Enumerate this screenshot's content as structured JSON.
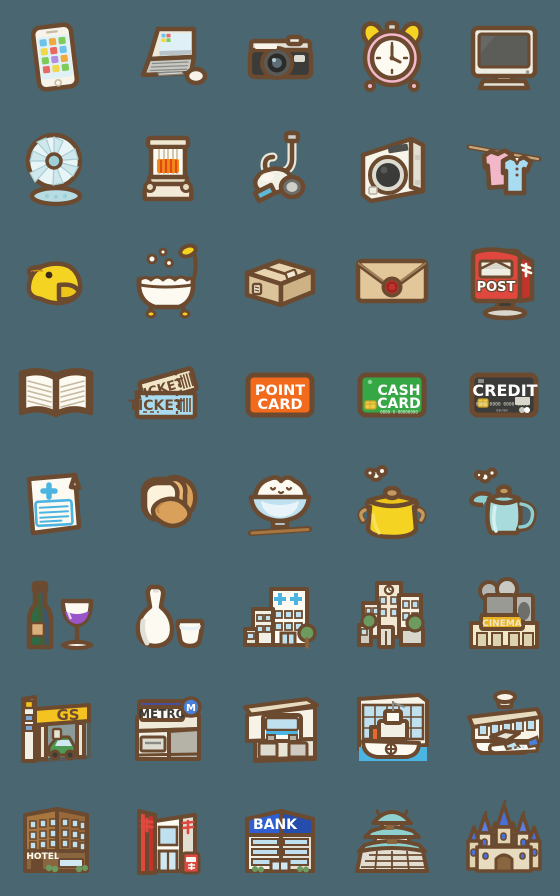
{
  "page": {
    "kind": "emoji-sticker-pack-preview",
    "background_color": "#4a6670",
    "outline_color": "#6b4a2f",
    "columns": 5,
    "rows": 8,
    "cell_size": 112,
    "total_icons": 40
  },
  "palette": {
    "background": "#4a6670",
    "outline": "#6b4a2f",
    "outline_light": "#8a6640",
    "white": "#fdfaf2",
    "cream": "#f2e6c8",
    "yellow": "#f5d322",
    "yellow_deep": "#e8c20c",
    "orange": "#f26a1b",
    "green": "#35a845",
    "green_dark": "#2e7d33",
    "red": "#e0483f",
    "red_dark": "#c2332c",
    "pink": "#f2b7c8",
    "blue": "#7fcbe0",
    "blue_light": "#bfe6f2",
    "blue_deep": "#2f5fd0",
    "teal": "#8ecfcf",
    "gray": "#b5b5b2",
    "gray_dark": "#4f4f4d",
    "purple": "#9a55c9",
    "tan": "#d9b07c",
    "brown": "#a87a4a"
  },
  "icons": [
    {
      "row": 1,
      "col": 1,
      "name": "smartphone-icon",
      "label": "Smartphone"
    },
    {
      "row": 1,
      "col": 2,
      "name": "laptop-icon",
      "label": "Laptop computer"
    },
    {
      "row": 1,
      "col": 3,
      "name": "camera-icon",
      "label": "Camera"
    },
    {
      "row": 1,
      "col": 4,
      "name": "alarm-clock-icon",
      "label": "Alarm clock"
    },
    {
      "row": 1,
      "col": 5,
      "name": "television-icon",
      "label": "Television"
    },
    {
      "row": 2,
      "col": 1,
      "name": "electric-fan-icon",
      "label": "Electric fan"
    },
    {
      "row": 2,
      "col": 2,
      "name": "kerosene-heater-icon",
      "label": "Kerosene heater"
    },
    {
      "row": 2,
      "col": 3,
      "name": "vacuum-cleaner-icon",
      "label": "Vacuum cleaner"
    },
    {
      "row": 2,
      "col": 4,
      "name": "washing-machine-icon",
      "label": "Washing machine"
    },
    {
      "row": 2,
      "col": 5,
      "name": "laundry-icon",
      "label": "Laundry on a pole"
    },
    {
      "row": 3,
      "col": 1,
      "name": "rubber-duck-icon",
      "label": "Rubber duck"
    },
    {
      "row": 3,
      "col": 2,
      "name": "bathtub-icon",
      "label": "Bathtub with shower"
    },
    {
      "row": 3,
      "col": 3,
      "name": "parcel-box-icon",
      "label": "Cardboard parcel"
    },
    {
      "row": 3,
      "col": 4,
      "name": "sealed-letter-icon",
      "label": "Sealed envelope"
    },
    {
      "row": 3,
      "col": 5,
      "name": "post-box-icon",
      "label": "Post box",
      "text": "POST",
      "text_color": "#ffffff",
      "body_color": "#e0483f"
    },
    {
      "row": 4,
      "col": 1,
      "name": "open-book-icon",
      "label": "Open book"
    },
    {
      "row": 4,
      "col": 2,
      "name": "tickets-icon",
      "label": "Tickets",
      "text": "TICKET",
      "text_color": "#6b4a2f",
      "body_color": "#a9dcf0"
    },
    {
      "row": 4,
      "col": 3,
      "name": "point-card-icon",
      "label": "Point card",
      "text": "POINT CARD",
      "text_color": "#ffffff",
      "body_color": "#f26a1b"
    },
    {
      "row": 4,
      "col": 4,
      "name": "cash-card-icon",
      "label": "Cash card",
      "text": "CASH CARD",
      "text_color": "#ffffff",
      "body_color": "#35a845",
      "sub_text": "0000-0-00000000"
    },
    {
      "row": 4,
      "col": 5,
      "name": "credit-card-icon",
      "label": "Credit card",
      "text": "CREDIT",
      "text_color": "#ffffff",
      "body_color": "#3b3b39",
      "sub_text": "0000 0000 0000 0000"
    },
    {
      "row": 5,
      "col": 1,
      "name": "prescription-icon",
      "label": "Prescription / medical note"
    },
    {
      "row": 5,
      "col": 2,
      "name": "bread-icon",
      "label": "Bread loaves"
    },
    {
      "row": 5,
      "col": 3,
      "name": "rice-bowl-icon",
      "label": "Bowl of rice with chopsticks"
    },
    {
      "row": 5,
      "col": 4,
      "name": "cooking-pot-icon",
      "label": "Yellow cooking pot"
    },
    {
      "row": 5,
      "col": 5,
      "name": "teapot-icon",
      "label": "Teapot"
    },
    {
      "row": 6,
      "col": 1,
      "name": "wine-icon",
      "label": "Wine bottle and glass"
    },
    {
      "row": 6,
      "col": 2,
      "name": "sake-set-icon",
      "label": "Sake bottle and cup"
    },
    {
      "row": 6,
      "col": 3,
      "name": "hospital-icon",
      "label": "Hospital"
    },
    {
      "row": 6,
      "col": 4,
      "name": "office-building-icon",
      "label": "Office building complex"
    },
    {
      "row": 6,
      "col": 5,
      "name": "cinema-icon",
      "label": "Cinema",
      "text": "CINEMA",
      "text_color": "#f2e6c8",
      "body_color": "#e8b424"
    },
    {
      "row": 7,
      "col": 1,
      "name": "gas-station-icon",
      "label": "Gas station",
      "text": "GS",
      "text_color": "#6b4a2f",
      "body_color": "#f5c320"
    },
    {
      "row": 7,
      "col": 2,
      "name": "metro-station-icon",
      "label": "Metro station",
      "text": "METRO",
      "text_color": "#3b3b39",
      "body_color": "#fdfaf2"
    },
    {
      "row": 7,
      "col": 3,
      "name": "train-station-icon",
      "label": "Train station"
    },
    {
      "row": 7,
      "col": 4,
      "name": "ferry-terminal-icon",
      "label": "Ferry terminal with ship"
    },
    {
      "row": 7,
      "col": 5,
      "name": "airport-icon",
      "label": "Airport with airplane"
    },
    {
      "row": 8,
      "col": 1,
      "name": "hotel-icon",
      "label": "Hotel",
      "text": "HOTEL",
      "text_color": "#fdfaf2",
      "body_color": "#a8763f"
    },
    {
      "row": 8,
      "col": 2,
      "name": "post-office-icon",
      "label": "Post office"
    },
    {
      "row": 8,
      "col": 3,
      "name": "bank-icon",
      "label": "Bank",
      "text": "BANK",
      "text_color": "#ffffff",
      "body_color": "#2f5fd0"
    },
    {
      "row": 8,
      "col": 4,
      "name": "japanese-castle-icon",
      "label": "Japanese castle"
    },
    {
      "row": 8,
      "col": 5,
      "name": "fairytale-castle-icon",
      "label": "Fairytale castle"
    }
  ]
}
